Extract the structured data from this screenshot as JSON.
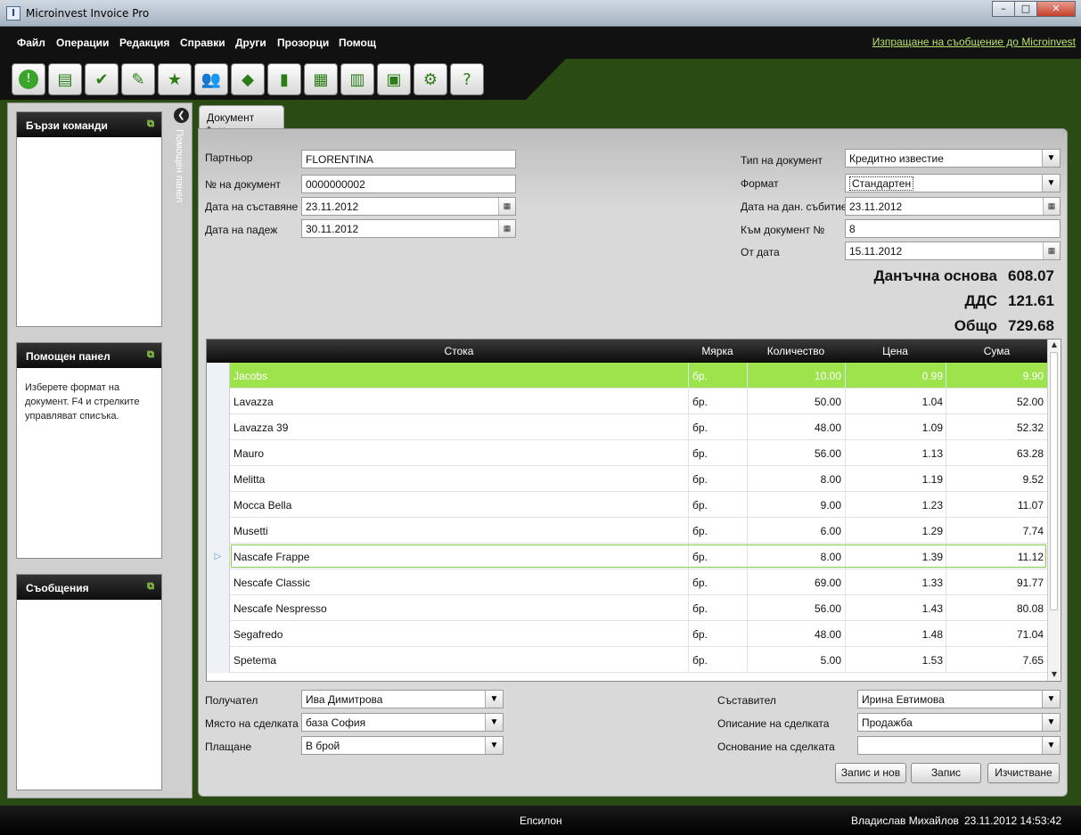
{
  "window": {
    "title": "Microinvest Invoice Pro"
  },
  "menu": {
    "items": [
      "Файл",
      "Операции",
      "Редакция",
      "Справки",
      "Други",
      "Прозорци",
      "Помощ"
    ],
    "link": "Изпращане на съобщение до Microinvest"
  },
  "toolbar": {
    "icons": [
      "power-icon",
      "document-icon",
      "check-icon",
      "edit-icon",
      "star-icon",
      "users-icon",
      "box-icon",
      "book-icon",
      "report-icon",
      "partner-doc-icon",
      "goods-icon",
      "settings-icon",
      "help-icon"
    ]
  },
  "left_panel": {
    "quick": {
      "title": "Бързи команди"
    },
    "help": {
      "title": "Помощен панел",
      "text": "Изберете формат на документ. F4 и стрелките управляват списъка."
    },
    "messages": {
      "title": "Съобщения"
    },
    "vertical_tab": "Помощен панел"
  },
  "tab": {
    "label": "Документ *"
  },
  "form": {
    "partner_label": "Партньор",
    "partner": "FLORENTINA",
    "docno_label": "№ на документ",
    "docno": "0000000002",
    "created_label": "Дата на съставяне",
    "created": "23.11.2012",
    "due_label": "Дата на падеж",
    "due": "30.11.2012",
    "doctype_label": "Тип на документ",
    "doctype": "Кредитно известие",
    "format_label": "Формат",
    "format": "Стандартен",
    "taxdate_label": "Дата на дан. събитие",
    "taxdate": "23.11.2012",
    "todoc_label": "Към документ №",
    "todoc": "8",
    "fromdate_label": "От дата",
    "fromdate": "15.11.2012"
  },
  "totals": {
    "base_label": "Данъчна основа",
    "base": "608.07",
    "vat_label": "ДДС",
    "vat": "121.61",
    "total_label": "Общо",
    "total": "729.68"
  },
  "grid": {
    "columns": [
      "Стока",
      "Мярка",
      "Количество",
      "Цена",
      "Сума"
    ],
    "rows": [
      [
        "Jacobs",
        "бр.",
        "10.00",
        "0.99",
        "9.90"
      ],
      [
        "Lavazza",
        "бр.",
        "50.00",
        "1.04",
        "52.00"
      ],
      [
        "Lavazza 39",
        "бр.",
        "48.00",
        "1.09",
        "52.32"
      ],
      [
        "Mauro",
        "бр.",
        "56.00",
        "1.13",
        "63.28"
      ],
      [
        "Melitta",
        "бр.",
        "8.00",
        "1.19",
        "9.52"
      ],
      [
        "Mocca Bella",
        "бр.",
        "9.00",
        "1.23",
        "11.07"
      ],
      [
        "Musetti",
        "бр.",
        "6.00",
        "1.29",
        "7.74"
      ],
      [
        "Nascafe Frappe",
        "бр.",
        "8.00",
        "1.39",
        "11.12"
      ],
      [
        "Nescafe Classic",
        "бр.",
        "69.00",
        "1.33",
        "91.77"
      ],
      [
        "Nescafe Nespresso",
        "бр.",
        "56.00",
        "1.43",
        "80.08"
      ],
      [
        "Segafredo",
        "бр.",
        "48.00",
        "1.48",
        "71.04"
      ],
      [
        "Spetema",
        "бр.",
        "5.00",
        "1.53",
        "7.65"
      ]
    ]
  },
  "bottom": {
    "receiver_label": "Получател",
    "receiver": "Ива Димитрова",
    "place_label": "Място на сделката",
    "place": "база София",
    "payment_label": "Плащане",
    "payment": "В брой",
    "author_label": "Съставител",
    "author": "Ирина Евтимова",
    "desc_label": "Описание на сделката",
    "desc": "Продажба",
    "basis_label": "Основание на сделката",
    "basis": ""
  },
  "buttons": {
    "save_new": "Запис и нов",
    "save": "Запис",
    "clear": "Изчистване"
  },
  "status": {
    "center": "Епсилон",
    "user": "Владислав Михайлов",
    "datetime": "23.11.2012 14:53:42"
  },
  "colors": {
    "accent_green": "#9de34b",
    "dark_green": "#2a4c12",
    "link": "#b8e36a"
  }
}
